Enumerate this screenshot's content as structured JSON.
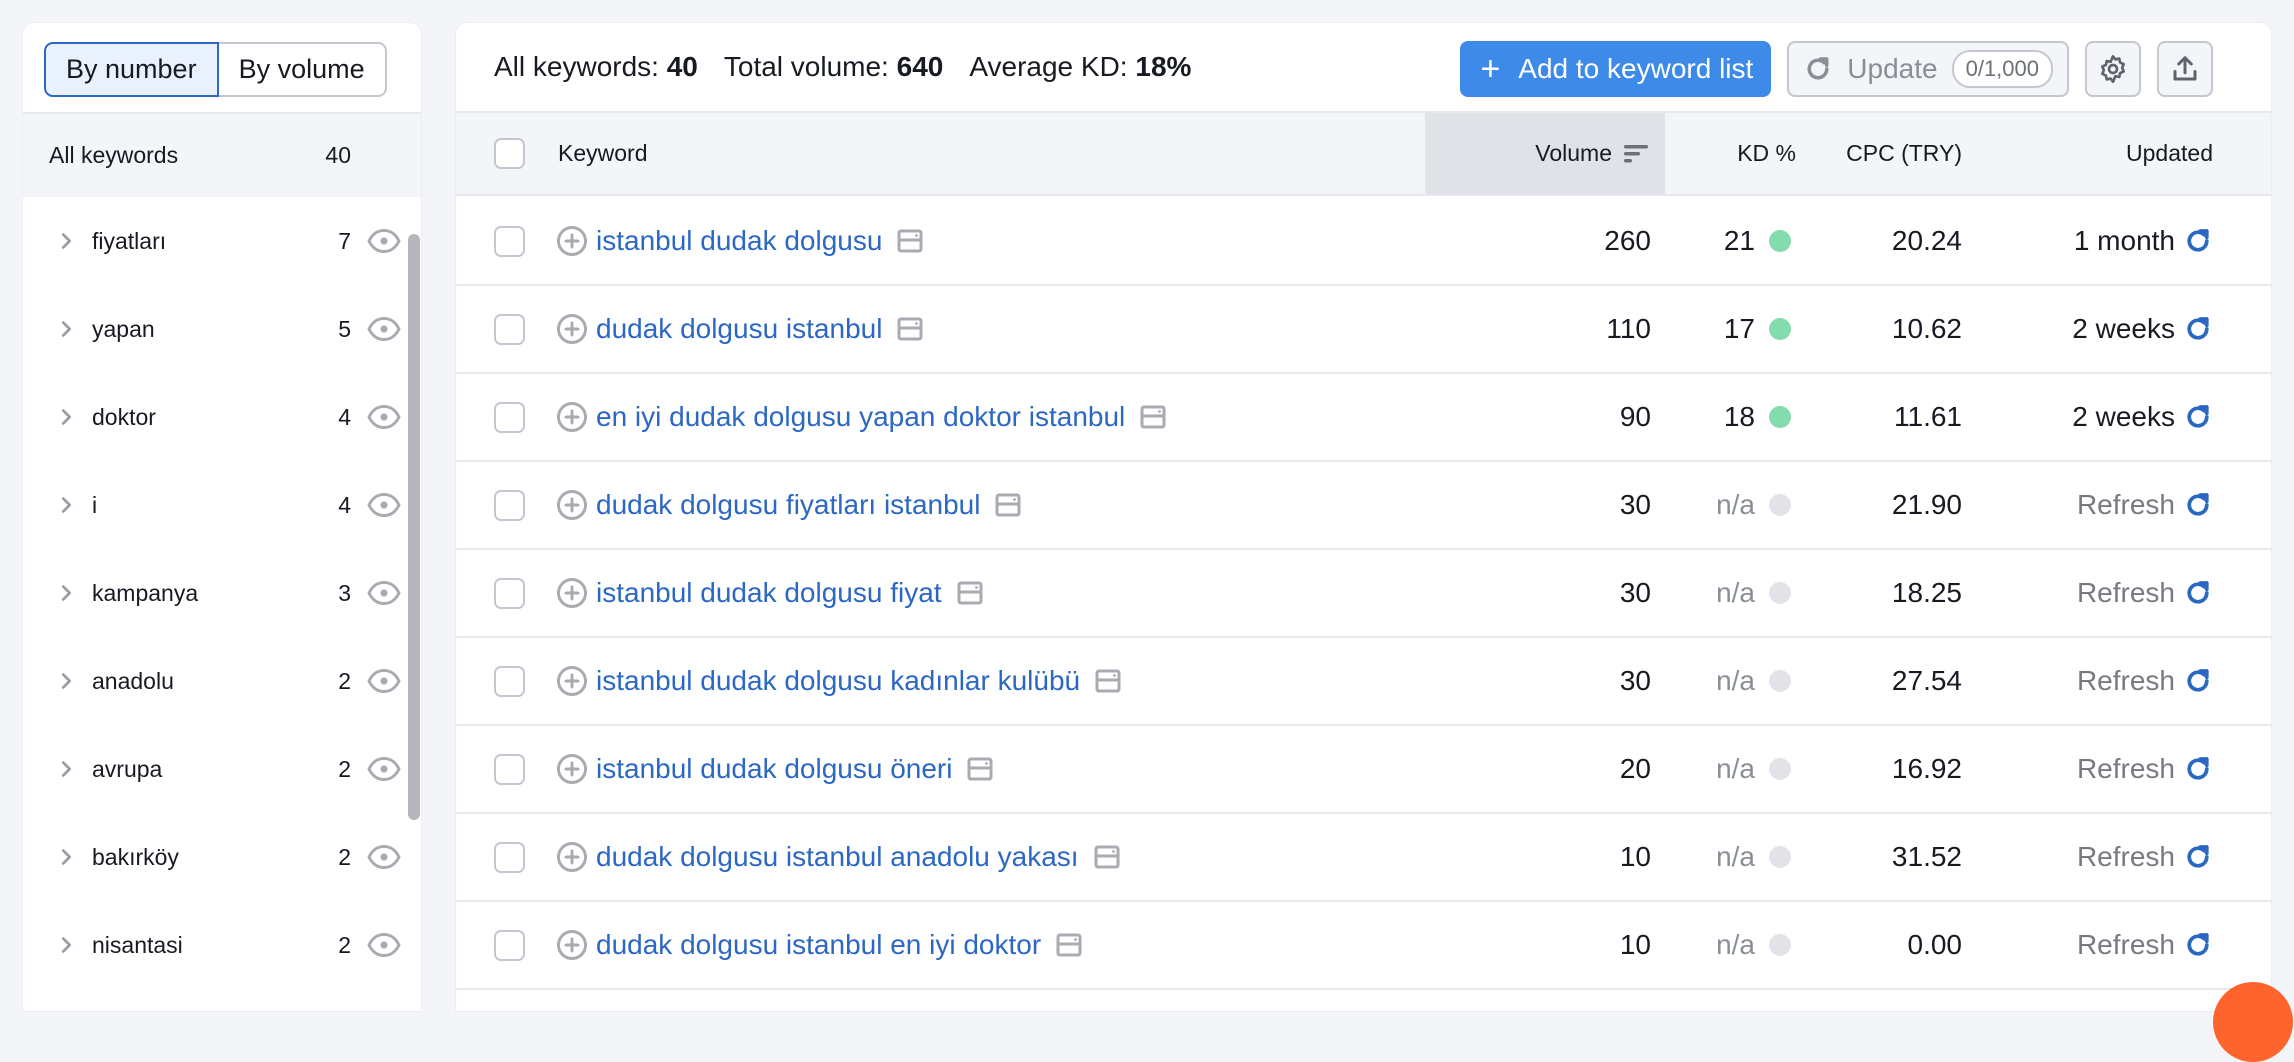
{
  "sidebar": {
    "toggle": {
      "by_number": "By number",
      "by_volume": "By volume",
      "active": "by_number"
    },
    "all_keywords": {
      "label": "All keywords",
      "count": "40"
    },
    "groups": [
      {
        "label": "fiyatları",
        "count": "7"
      },
      {
        "label": "yapan",
        "count": "5"
      },
      {
        "label": "doktor",
        "count": "4"
      },
      {
        "label": "i",
        "count": "4"
      },
      {
        "label": "kampanya",
        "count": "3"
      },
      {
        "label": "anadolu",
        "count": "2"
      },
      {
        "label": "avrupa",
        "count": "2"
      },
      {
        "label": "bakırköy",
        "count": "2"
      },
      {
        "label": "nisantasi",
        "count": "2"
      }
    ]
  },
  "stats": {
    "all_keywords_label": "All keywords:",
    "all_keywords_value": "40",
    "total_volume_label": "Total volume:",
    "total_volume_value": "640",
    "avg_kd_label": "Average KD:",
    "avg_kd_value": "18%"
  },
  "toolbar": {
    "add_label": "Add to keyword list",
    "update_label": "Update",
    "quota": "0/1,000",
    "icons": [
      "settings-icon",
      "export-icon"
    ]
  },
  "table": {
    "columns": {
      "keyword": "Keyword",
      "volume": "Volume",
      "kd": "KD %",
      "cpc": "CPC (TRY)",
      "updated": "Updated"
    },
    "sorted_by": "volume",
    "colors": {
      "kd_easy": "#83dcad",
      "kd_na": "#e2e3e8",
      "link": "#2c67c4",
      "accent": "#3d8ae8"
    },
    "rows": [
      {
        "keyword": "istanbul dudak dolgusu",
        "volume": "260",
        "kd": "21",
        "kd_status": "easy",
        "cpc": "20.24",
        "updated": "1 month",
        "updated_type": "time"
      },
      {
        "keyword": "dudak dolgusu istanbul",
        "volume": "110",
        "kd": "17",
        "kd_status": "easy",
        "cpc": "10.62",
        "updated": "2 weeks",
        "updated_type": "time"
      },
      {
        "keyword": "en iyi dudak dolgusu yapan doktor istanbul",
        "volume": "90",
        "kd": "18",
        "kd_status": "easy",
        "cpc": "11.61",
        "updated": "2 weeks",
        "updated_type": "time"
      },
      {
        "keyword": "dudak dolgusu fiyatları istanbul",
        "volume": "30",
        "kd": "n/a",
        "kd_status": "na",
        "cpc": "21.90",
        "updated": "Refresh",
        "updated_type": "refresh"
      },
      {
        "keyword": "istanbul dudak dolgusu fiyat",
        "volume": "30",
        "kd": "n/a",
        "kd_status": "na",
        "cpc": "18.25",
        "updated": "Refresh",
        "updated_type": "refresh"
      },
      {
        "keyword": "istanbul dudak dolgusu kadınlar kulübü",
        "volume": "30",
        "kd": "n/a",
        "kd_status": "na",
        "cpc": "27.54",
        "updated": "Refresh",
        "updated_type": "refresh"
      },
      {
        "keyword": "istanbul dudak dolgusu öneri",
        "volume": "20",
        "kd": "n/a",
        "kd_status": "na",
        "cpc": "16.92",
        "updated": "Refresh",
        "updated_type": "refresh"
      },
      {
        "keyword": "dudak dolgusu istanbul anadolu yakası",
        "volume": "10",
        "kd": "n/a",
        "kd_status": "na",
        "cpc": "31.52",
        "updated": "Refresh",
        "updated_type": "refresh"
      },
      {
        "keyword": "dudak dolgusu istanbul en iyi doktor",
        "volume": "10",
        "kd": "n/a",
        "kd_status": "na",
        "cpc": "0.00",
        "updated": "Refresh",
        "updated_type": "refresh"
      }
    ]
  }
}
